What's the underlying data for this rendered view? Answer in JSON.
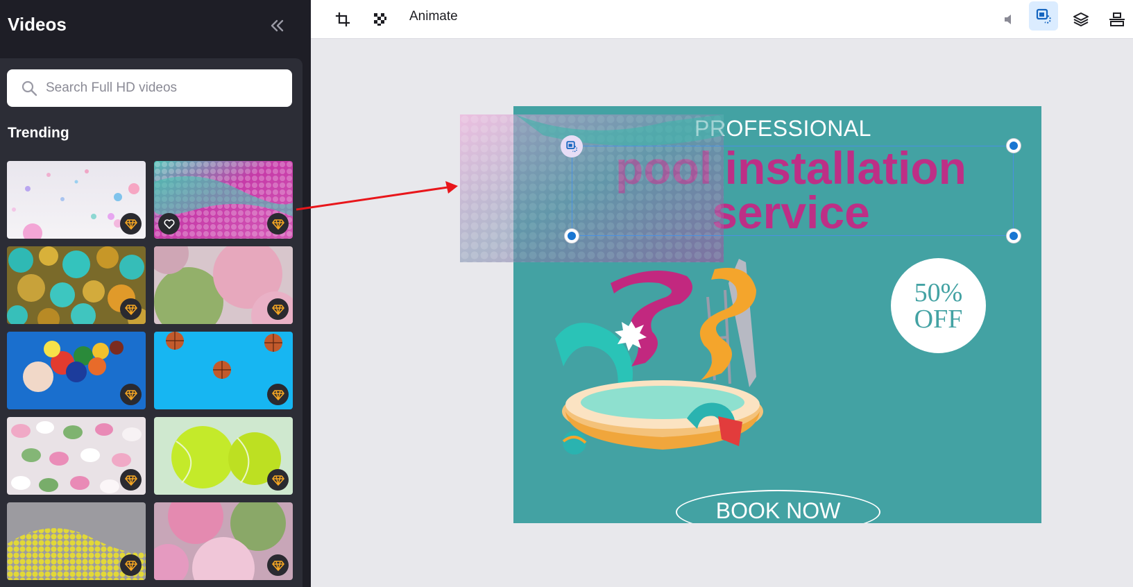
{
  "sidebar": {
    "title": "Videos",
    "search": {
      "placeholder": "Search Full HD videos",
      "value": ""
    },
    "section_label": "Trending",
    "thumbnails": [
      {
        "subject": "floating pastel spheres",
        "badge": "premium-icon"
      },
      {
        "subject": "pink and teal ball pit",
        "badge": "premium-icon",
        "favorite": "heart-icon"
      },
      {
        "subject": "striped teal and gold balls",
        "badge": "premium-icon"
      },
      {
        "subject": "pink and green felt balls",
        "badge": "premium-icon"
      },
      {
        "subject": "billiard balls on blue",
        "badge": "premium-icon"
      },
      {
        "subject": "basketballs on blue",
        "badge": "premium-icon"
      },
      {
        "subject": "pastel candy eggs",
        "badge": "premium-icon"
      },
      {
        "subject": "tennis balls",
        "badge": "premium-icon"
      },
      {
        "subject": "yellow balls pile",
        "badge": "premium-icon"
      },
      {
        "subject": "pink felt balls close-up",
        "badge": "premium-icon"
      }
    ]
  },
  "toolbar": {
    "animate_label": "Animate",
    "left_tools": [
      "crop-icon",
      "transparency-icon"
    ],
    "right_tools": [
      "mute-icon",
      "replace-icon",
      "layers-icon",
      "align-icon"
    ]
  },
  "design": {
    "headline_small": "PROFESSIONAL",
    "headline_line1": "pool installation",
    "headline_line2": "service",
    "discount_line1": "50%",
    "discount_line2": "OFF",
    "cta": "BOOK NOW",
    "colors": {
      "background": "#43a2a3",
      "headline": "#bd2f86",
      "white": "#ffffff"
    }
  }
}
